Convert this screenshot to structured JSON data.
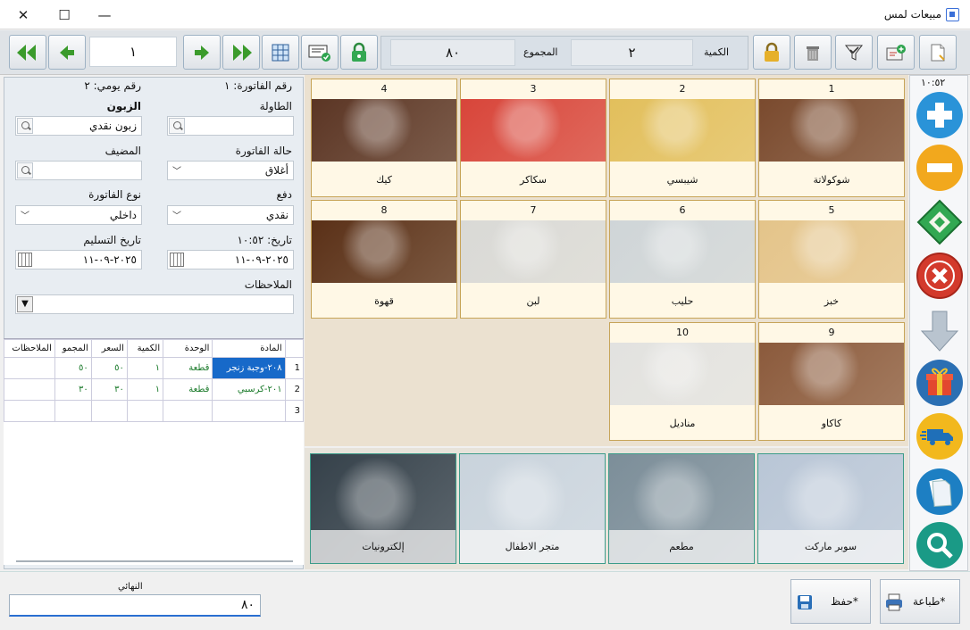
{
  "window": {
    "title": "مبيعات لمس",
    "minimize": "—",
    "maximize": "☐",
    "close": "✕"
  },
  "toolbar": {
    "quantity_label": "الكمية",
    "quantity_value": "٢",
    "total_label": "المجموع",
    "total_value": "٨٠",
    "invoice_index": "١"
  },
  "form": {
    "invoice_no": "رقم الفاتورة: ١",
    "daily_no": "رقم يومي: ٢",
    "table_label": "الطاولة",
    "customer_label": "الزبون",
    "customer_value": "زبون نقدي",
    "state_label": "حالة الفاتورة",
    "state_value": "أغلاق",
    "host_label": "المضيف",
    "payment_label": "دفع",
    "payment_value": "نقدي",
    "type_label": "نوع الفاتورة",
    "type_value": "داخلي",
    "date_label": "تاريخ: ١٠:٥٢",
    "date_value": "٢٠٢٥-٠٩-١١",
    "delivery_label": "تاريخ التسليم",
    "delivery_value": "٢٠٢٥-٠٩-١١",
    "notes_label": "الملاحظات"
  },
  "grid": {
    "headers": [
      "المادة",
      "الوحدة",
      "الكمية",
      "السعر",
      "المجمو",
      "الملاحظات"
    ],
    "rows": [
      {
        "idx": "1",
        "item": "٢٠٨-وجبة زنجر",
        "unit": "قطعة",
        "qty": "١",
        "price": "٥٠",
        "total": "٥٠",
        "notes": ""
      },
      {
        "idx": "2",
        "item": "٢٠١-كرسبي",
        "unit": "قطعة",
        "qty": "١",
        "price": "٣٠",
        "total": "٣٠",
        "notes": ""
      },
      {
        "idx": "3",
        "item": "",
        "unit": "",
        "qty": "",
        "price": "",
        "total": "",
        "notes": ""
      }
    ]
  },
  "products": [
    {
      "num": "1",
      "name": "شوكولاتة",
      "icon": "chocolate",
      "color": "#7a4a2e"
    },
    {
      "num": "2",
      "name": "شيبسي",
      "icon": "chips",
      "color": "#e2bf5c"
    },
    {
      "num": "3",
      "name": "سكاكر",
      "icon": "candy",
      "color": "#d8453a"
    },
    {
      "num": "4",
      "name": "كيك",
      "icon": "cake",
      "color": "#5b3524"
    },
    {
      "num": "5",
      "name": "خبز",
      "icon": "bread",
      "color": "#e4c48a"
    },
    {
      "num": "6",
      "name": "حليب",
      "icon": "milk",
      "color": "#cfd5d8"
    },
    {
      "num": "7",
      "name": "لبن",
      "icon": "yogurt",
      "color": "#d9d9d6"
    },
    {
      "num": "8",
      "name": "قهوة",
      "icon": "coffee-beans",
      "color": "#5a3017"
    },
    {
      "num": "9",
      "name": "كاكاو",
      "icon": "cocoa",
      "color": "#8b5a3c"
    },
    {
      "num": "10",
      "name": "مناديل",
      "icon": "tissues",
      "color": "#e2e2e0"
    }
  ],
  "categories": [
    {
      "name": "سوبر ماركت",
      "icon": "supermarket",
      "color": "#b9c6d6"
    },
    {
      "name": "مطعم",
      "icon": "restaurant",
      "color": "#7c8e99"
    },
    {
      "name": "متجر الاطفال",
      "icon": "kids-store",
      "color": "#c9d3dc"
    },
    {
      "name": "إلكترونيات",
      "icon": "electronics",
      "color": "#35414a"
    }
  ],
  "sidebar": {
    "time": "١٠:٥٢"
  },
  "bottom": {
    "final_label": "النهائي",
    "final_value": "٨٠",
    "save_label": "حفظ*",
    "print_label": "طباعة*"
  }
}
